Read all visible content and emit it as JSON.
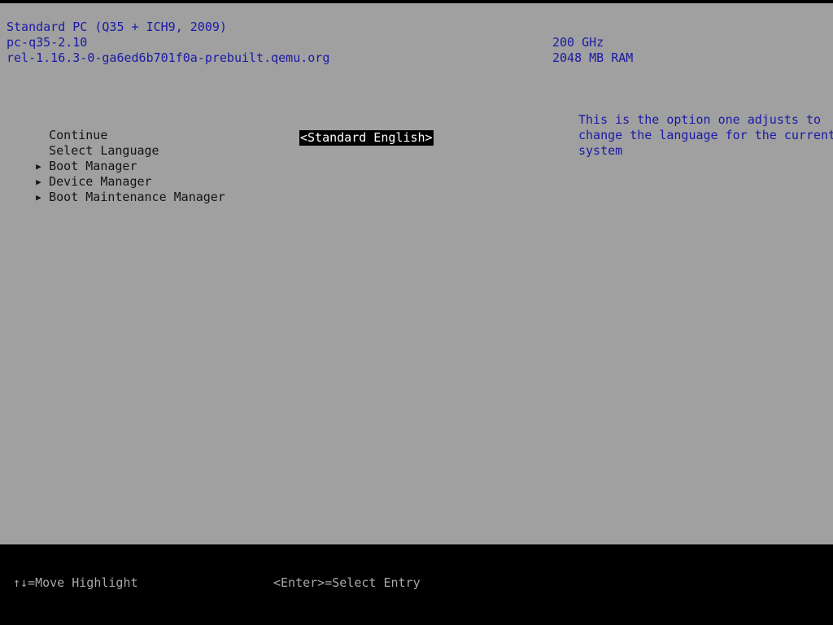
{
  "system_info": {
    "machine": "Standard PC (Q35 + ICH9, 2009)",
    "version": "pc-q35-2.10",
    "firmware": "rel-1.16.3-0-ga6ed6b701f0a-prebuilt.qemu.org",
    "cpu_speed": "200 GHz",
    "memory": "2048 MB RAM"
  },
  "menu": {
    "items": [
      {
        "label": "Continue",
        "submenu": false
      },
      {
        "label": "Select Language",
        "submenu": false
      },
      {
        "label": "Boot Manager",
        "submenu": true
      },
      {
        "label": "Device Manager",
        "submenu": true
      },
      {
        "label": "Boot Maintenance Manager",
        "submenu": true
      }
    ],
    "language_value": "<Standard English>",
    "submenu_marker": "▶"
  },
  "help": {
    "lines": [
      "This is the option one adjusts to",
      "change the language for the current",
      "system"
    ]
  },
  "footer": {
    "move_hint": "↑↓=Move Highlight",
    "enter_hint": "<Enter>=Select Entry"
  },
  "colors": {
    "background": "#a0a0a0",
    "info_text": "#1a1aa6",
    "menu_text": "#141414",
    "highlight_bg": "#000000",
    "highlight_text": "#ffffff",
    "footer_bg": "#000000",
    "footer_text": "#a8a8a8"
  }
}
